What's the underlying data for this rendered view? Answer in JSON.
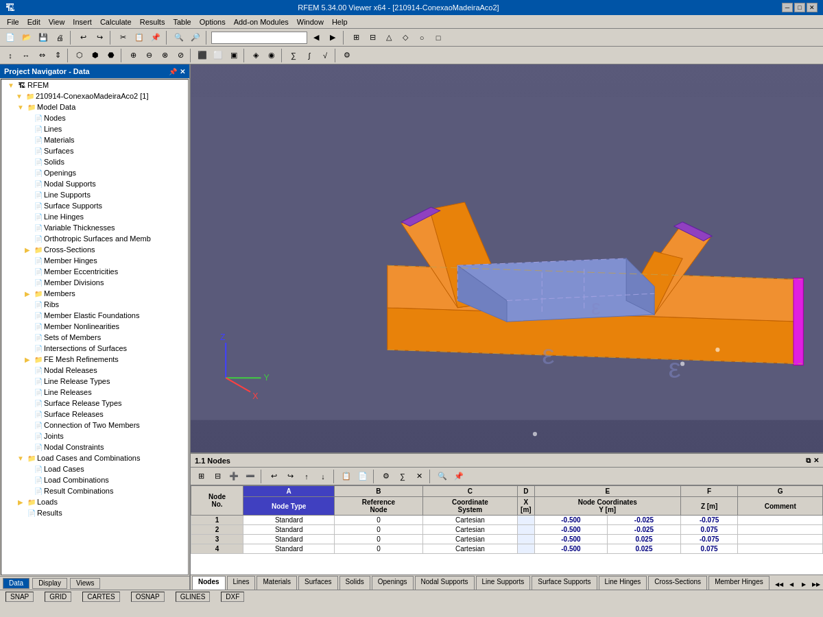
{
  "titleBar": {
    "title": "RFEM 5.34.00 Viewer x64 - [210914-ConexaoMadeiraAco2]",
    "minBtn": "─",
    "maxBtn": "□",
    "closeBtn": "✕"
  },
  "menuBar": {
    "items": [
      "File",
      "Edit",
      "View",
      "Insert",
      "Calculate",
      "Results",
      "Table",
      "Options",
      "Add-on Modules",
      "Window",
      "Help"
    ]
  },
  "leftPanel": {
    "title": "Project Navigator - Data",
    "pinBtn": "📌",
    "closeBtn": "✕",
    "tree": {
      "root": "RFEM",
      "project": "210914-ConexaoMadeiraAco2 [1]",
      "items": [
        {
          "label": "Model Data",
          "indent": 2,
          "type": "folder",
          "expanded": true
        },
        {
          "label": "Nodes",
          "indent": 3,
          "type": "item"
        },
        {
          "label": "Lines",
          "indent": 3,
          "type": "item"
        },
        {
          "label": "Materials",
          "indent": 3,
          "type": "item"
        },
        {
          "label": "Surfaces",
          "indent": 3,
          "type": "item"
        },
        {
          "label": "Solids",
          "indent": 3,
          "type": "item"
        },
        {
          "label": "Openings",
          "indent": 3,
          "type": "item"
        },
        {
          "label": "Nodal Supports",
          "indent": 3,
          "type": "item"
        },
        {
          "label": "Line Supports",
          "indent": 3,
          "type": "item"
        },
        {
          "label": "Surface Supports",
          "indent": 3,
          "type": "item"
        },
        {
          "label": "Line Hinges",
          "indent": 3,
          "type": "item"
        },
        {
          "label": "Variable Thicknesses",
          "indent": 3,
          "type": "item"
        },
        {
          "label": "Orthotropic Surfaces and Memb",
          "indent": 3,
          "type": "item"
        },
        {
          "label": "Cross-Sections",
          "indent": 3,
          "type": "folder"
        },
        {
          "label": "Member Hinges",
          "indent": 3,
          "type": "item"
        },
        {
          "label": "Member Eccentricities",
          "indent": 3,
          "type": "item"
        },
        {
          "label": "Member Divisions",
          "indent": 3,
          "type": "item"
        },
        {
          "label": "Members",
          "indent": 3,
          "type": "folder"
        },
        {
          "label": "Ribs",
          "indent": 3,
          "type": "item"
        },
        {
          "label": "Member Elastic Foundations",
          "indent": 3,
          "type": "item"
        },
        {
          "label": "Member Nonlinearities",
          "indent": 3,
          "type": "item"
        },
        {
          "label": "Sets of Members",
          "indent": 3,
          "type": "item"
        },
        {
          "label": "Intersections of Surfaces",
          "indent": 3,
          "type": "item"
        },
        {
          "label": "FE Mesh Refinements",
          "indent": 3,
          "type": "folder"
        },
        {
          "label": "Nodal Releases",
          "indent": 3,
          "type": "item"
        },
        {
          "label": "Line Release Types",
          "indent": 3,
          "type": "item"
        },
        {
          "label": "Line Releases",
          "indent": 3,
          "type": "item"
        },
        {
          "label": "Surface Release Types",
          "indent": 3,
          "type": "item"
        },
        {
          "label": "Surface Releases",
          "indent": 3,
          "type": "item"
        },
        {
          "label": "Connection of Two Members",
          "indent": 3,
          "type": "item"
        },
        {
          "label": "Joints",
          "indent": 3,
          "type": "item"
        },
        {
          "label": "Nodal Constraints",
          "indent": 3,
          "type": "item"
        },
        {
          "label": "Load Cases and Combinations",
          "indent": 2,
          "type": "folder",
          "expanded": true
        },
        {
          "label": "Load Cases",
          "indent": 3,
          "type": "item"
        },
        {
          "label": "Load Combinations",
          "indent": 3,
          "type": "item"
        },
        {
          "label": "Result Combinations",
          "indent": 3,
          "type": "item"
        },
        {
          "label": "Loads",
          "indent": 2,
          "type": "folder"
        },
        {
          "label": "Results",
          "indent": 2,
          "type": "item"
        }
      ]
    },
    "tabs": [
      {
        "label": "Data",
        "active": true
      },
      {
        "label": "Display",
        "active": false
      },
      {
        "label": "Views",
        "active": false
      }
    ]
  },
  "bottomPanel": {
    "title": "1.1 Nodes",
    "columns": [
      {
        "id": "A",
        "label": "A",
        "sub1": "Node Type",
        "highlight": true
      },
      {
        "id": "B",
        "label": "B",
        "sub1": "Reference",
        "sub2": "Node"
      },
      {
        "id": "C",
        "label": "C",
        "sub1": "Coordinate",
        "sub2": "System"
      },
      {
        "id": "D",
        "label": "D",
        "sub1": "X [m]"
      },
      {
        "id": "E",
        "label": "E",
        "sub1": "Node Coordinates",
        "sub2": "Y [m]"
      },
      {
        "id": "F",
        "label": "F",
        "sub1": "Z [m]"
      },
      {
        "id": "G",
        "label": "G",
        "sub1": "Comment"
      }
    ],
    "nodeNoLabel": "Node No.",
    "rows": [
      {
        "no": 1,
        "nodeType": "Standard",
        "refNode": "0",
        "coordSystem": "Cartesian",
        "x": "-0.500",
        "y": "-0.025",
        "z": "-0.075",
        "comment": ""
      },
      {
        "no": 2,
        "nodeType": "Standard",
        "refNode": "0",
        "coordSystem": "Cartesian",
        "x": "-0.500",
        "y": "-0.025",
        "z": "0.075",
        "comment": ""
      },
      {
        "no": 3,
        "nodeType": "Standard",
        "refNode": "0",
        "coordSystem": "Cartesian",
        "x": "-0.500",
        "y": "0.025",
        "z": "-0.075",
        "comment": ""
      },
      {
        "no": 4,
        "nodeType": "Standard",
        "refNode": "0",
        "coordSystem": "Cartesian",
        "x": "-0.500",
        "y": "0.025",
        "z": "0.075",
        "comment": ""
      }
    ],
    "tabs": [
      "Nodes",
      "Lines",
      "Materials",
      "Surfaces",
      "Solids",
      "Openings",
      "Nodal Supports",
      "Line Supports",
      "Surface Supports",
      "Line Hinges",
      "Cross-Sections",
      "Member Hinges"
    ]
  },
  "statusBar": {
    "items": [
      "SNAP",
      "GRID",
      "CARTES",
      "OSNAP",
      "GLINES",
      "DXF"
    ]
  },
  "viewport": {
    "title": ""
  }
}
